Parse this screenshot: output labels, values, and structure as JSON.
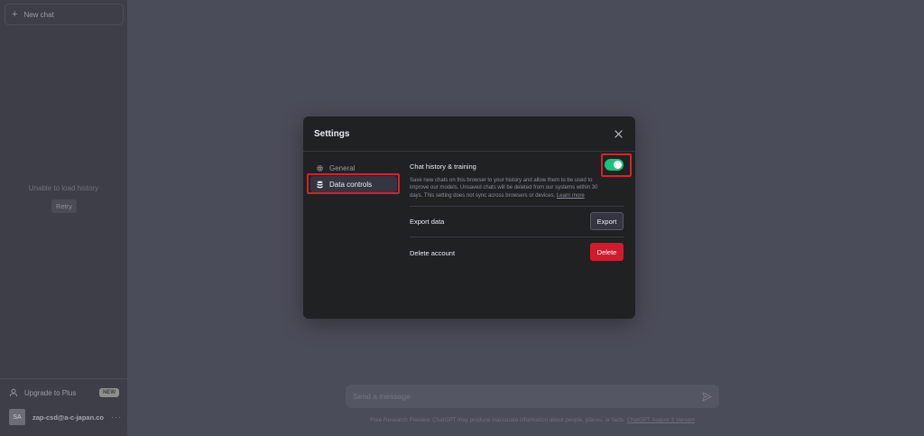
{
  "sidebar": {
    "new_chat_label": "New chat",
    "load_message": "Unable to load history",
    "retry_label": "Retry",
    "upgrade_label": "Upgrade to Plus",
    "new_badge": "NEW",
    "avatar_initials": "SA",
    "account_email": "zap-csd@a-c-japan.co",
    "more_label": "···"
  },
  "composer": {
    "placeholder": "Send a message"
  },
  "footer": {
    "note": "Free Research Preview. ChatGPT may produce inaccurate information about people, places, or facts.",
    "version_link": "ChatGPT August 3 Version"
  },
  "settings": {
    "title": "Settings",
    "tabs": [
      {
        "label": "General",
        "icon": "gear-icon"
      },
      {
        "label": "Data controls",
        "icon": "database-icon"
      }
    ],
    "selected_tab": "Data controls",
    "history": {
      "title": "Chat history & training",
      "description": "Save new chats on this browser to your history and allow them to be used to improve our models. Unsaved chats will be deleted from our systems within 30 days. This setting does not sync across browsers or devices.",
      "learn_more": "Learn more",
      "enabled": true
    },
    "export": {
      "title": "Export data",
      "button": "Export"
    },
    "delete": {
      "title": "Delete account",
      "button": "Delete"
    }
  },
  "colors": {
    "toggle_on": "#19c37d",
    "delete_red": "#d11b2a",
    "highlight_red": "#d9202d",
    "modal_bg": "#202123"
  }
}
